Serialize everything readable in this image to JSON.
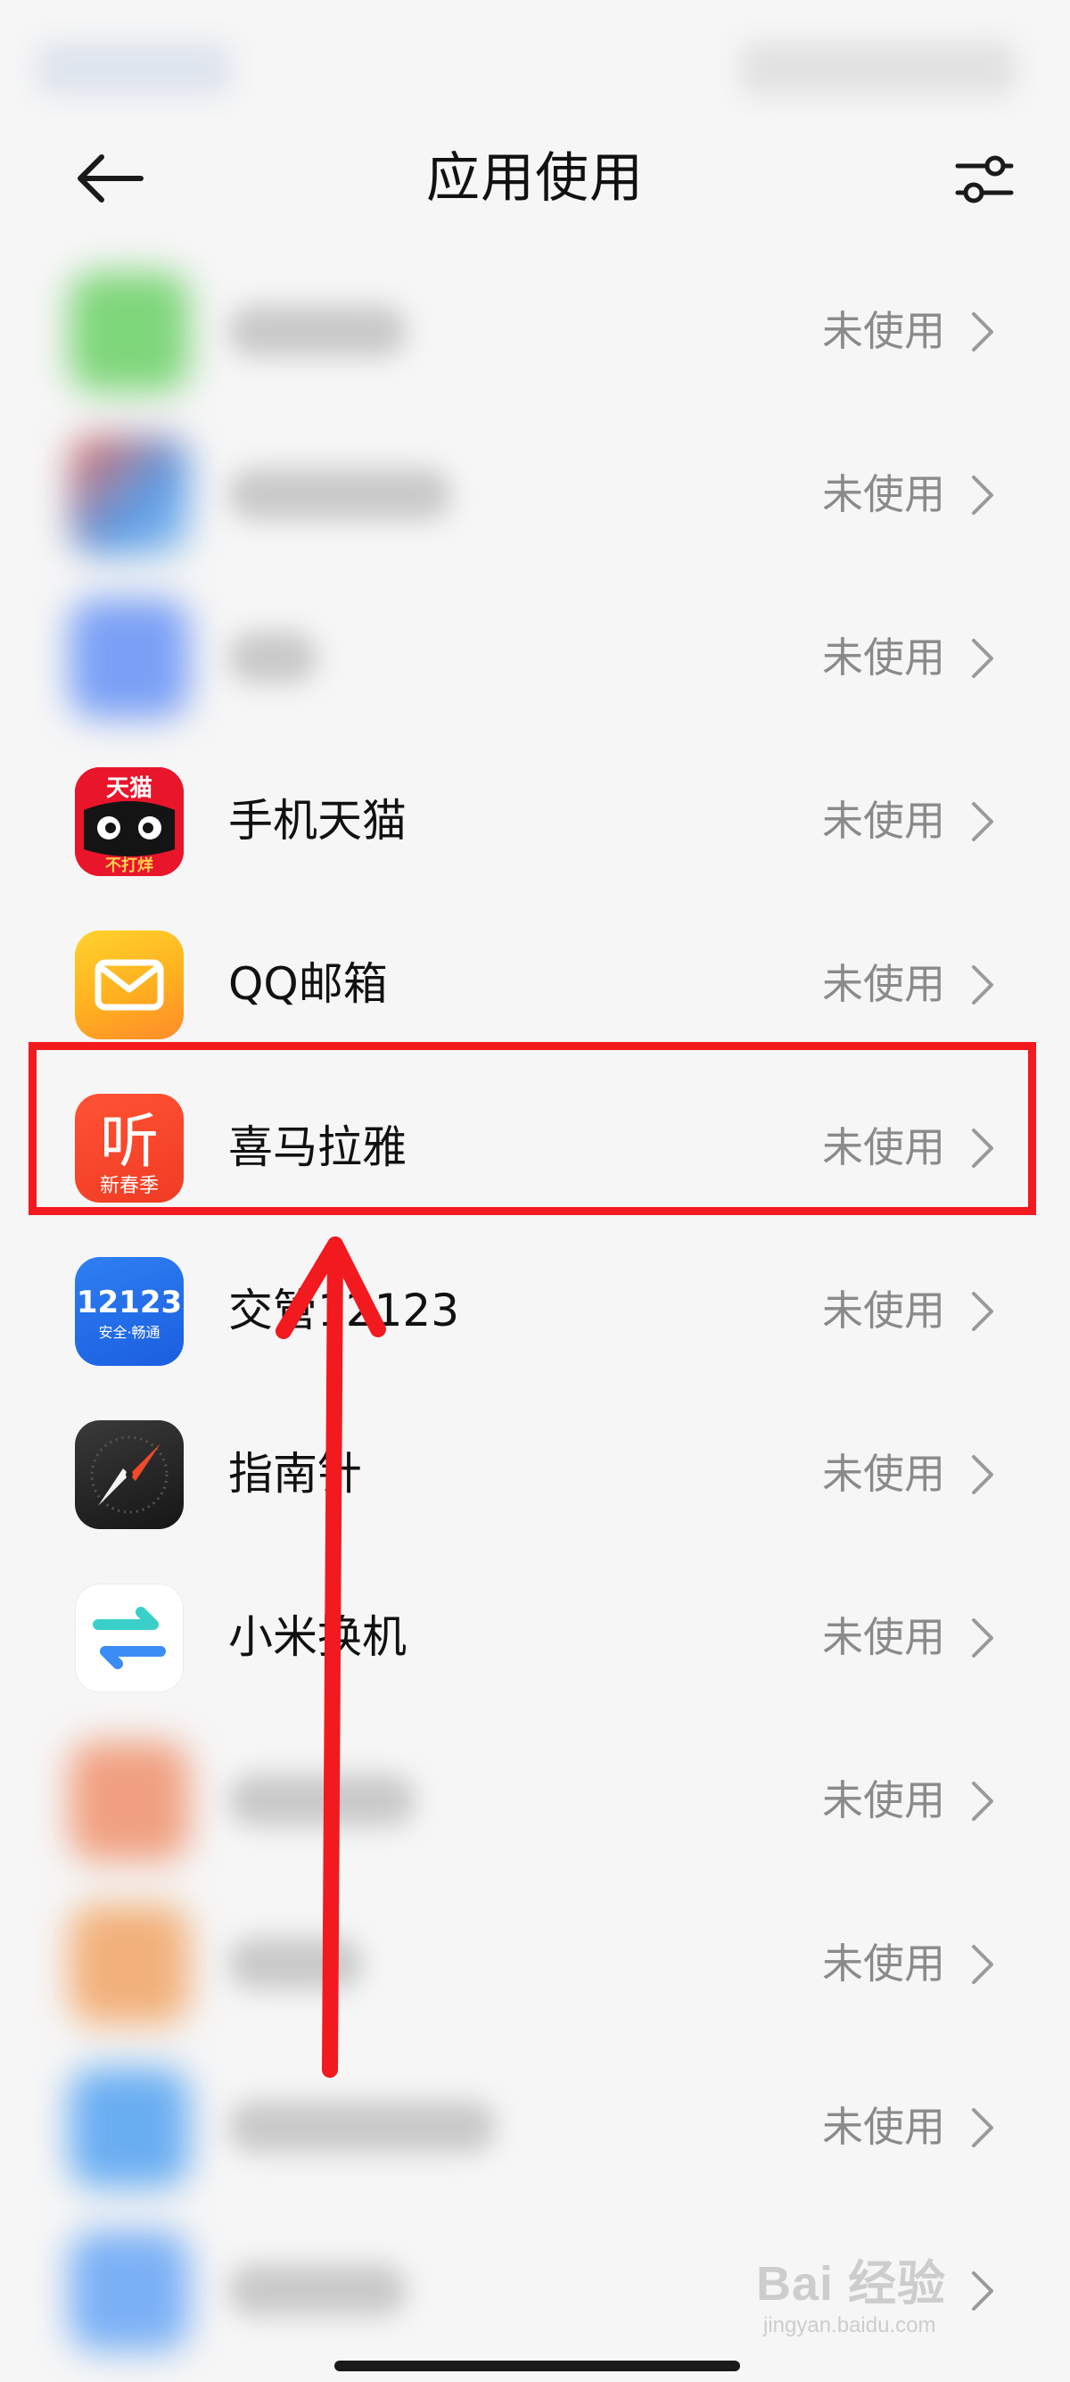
{
  "header": {
    "title": "应用使用",
    "back_icon": "back-arrow-icon",
    "filter_icon": "filter-sliders-icon"
  },
  "apps": [
    {
      "name": "",
      "status": "未使用",
      "blurred": true,
      "icon_color": "#7ed67a"
    },
    {
      "name": "",
      "status": "未使用",
      "blurred": true,
      "icon_color": "#5a9be6"
    },
    {
      "name": "",
      "status": "未使用",
      "blurred": true,
      "icon_color": "#7aa0f5"
    },
    {
      "name": "手机天猫",
      "status": "未使用",
      "blurred": false,
      "icon": "tmall-icon",
      "icon_text_top": "天猫",
      "icon_text_bottom": "不打烊"
    },
    {
      "name": "QQ邮箱",
      "status": "未使用",
      "blurred": false,
      "icon": "qq-mail-icon"
    },
    {
      "name": "喜马拉雅",
      "status": "未使用",
      "blurred": false,
      "icon": "ximalaya-icon",
      "icon_text_top": "听",
      "icon_text_bottom": "新春季",
      "highlighted": true
    },
    {
      "name": "交管12123",
      "status": "未使用",
      "blurred": false,
      "icon": "jiaoguan-12123-icon",
      "icon_text_top": "12123",
      "icon_text_bottom": "安全·畅通"
    },
    {
      "name": "指南针",
      "status": "未使用",
      "blurred": false,
      "icon": "compass-icon"
    },
    {
      "name": "小米换机",
      "status": "未使用",
      "blurred": false,
      "icon": "mi-mover-icon"
    },
    {
      "name": "",
      "status": "未使用",
      "blurred": true,
      "icon_color": "#f0a080"
    },
    {
      "name": "",
      "status": "未使用",
      "blurred": true,
      "icon_color": "#f2b07a"
    },
    {
      "name": "",
      "status": "未使用",
      "blurred": true,
      "icon_color": "#6aaef2"
    },
    {
      "name": "",
      "status": "",
      "blurred": true,
      "icon_color": "#7ab0f5"
    }
  ],
  "colors": {
    "highlight": "#f2191f",
    "status_text": "#8a8a8a",
    "background": "#f6f6f6"
  },
  "annotation": {
    "highlight_target": "喜马拉雅",
    "arrow": "up-arrow-annotation"
  },
  "watermark": {
    "logo": "Bai 经验",
    "url": "jingyan.baidu.com"
  }
}
